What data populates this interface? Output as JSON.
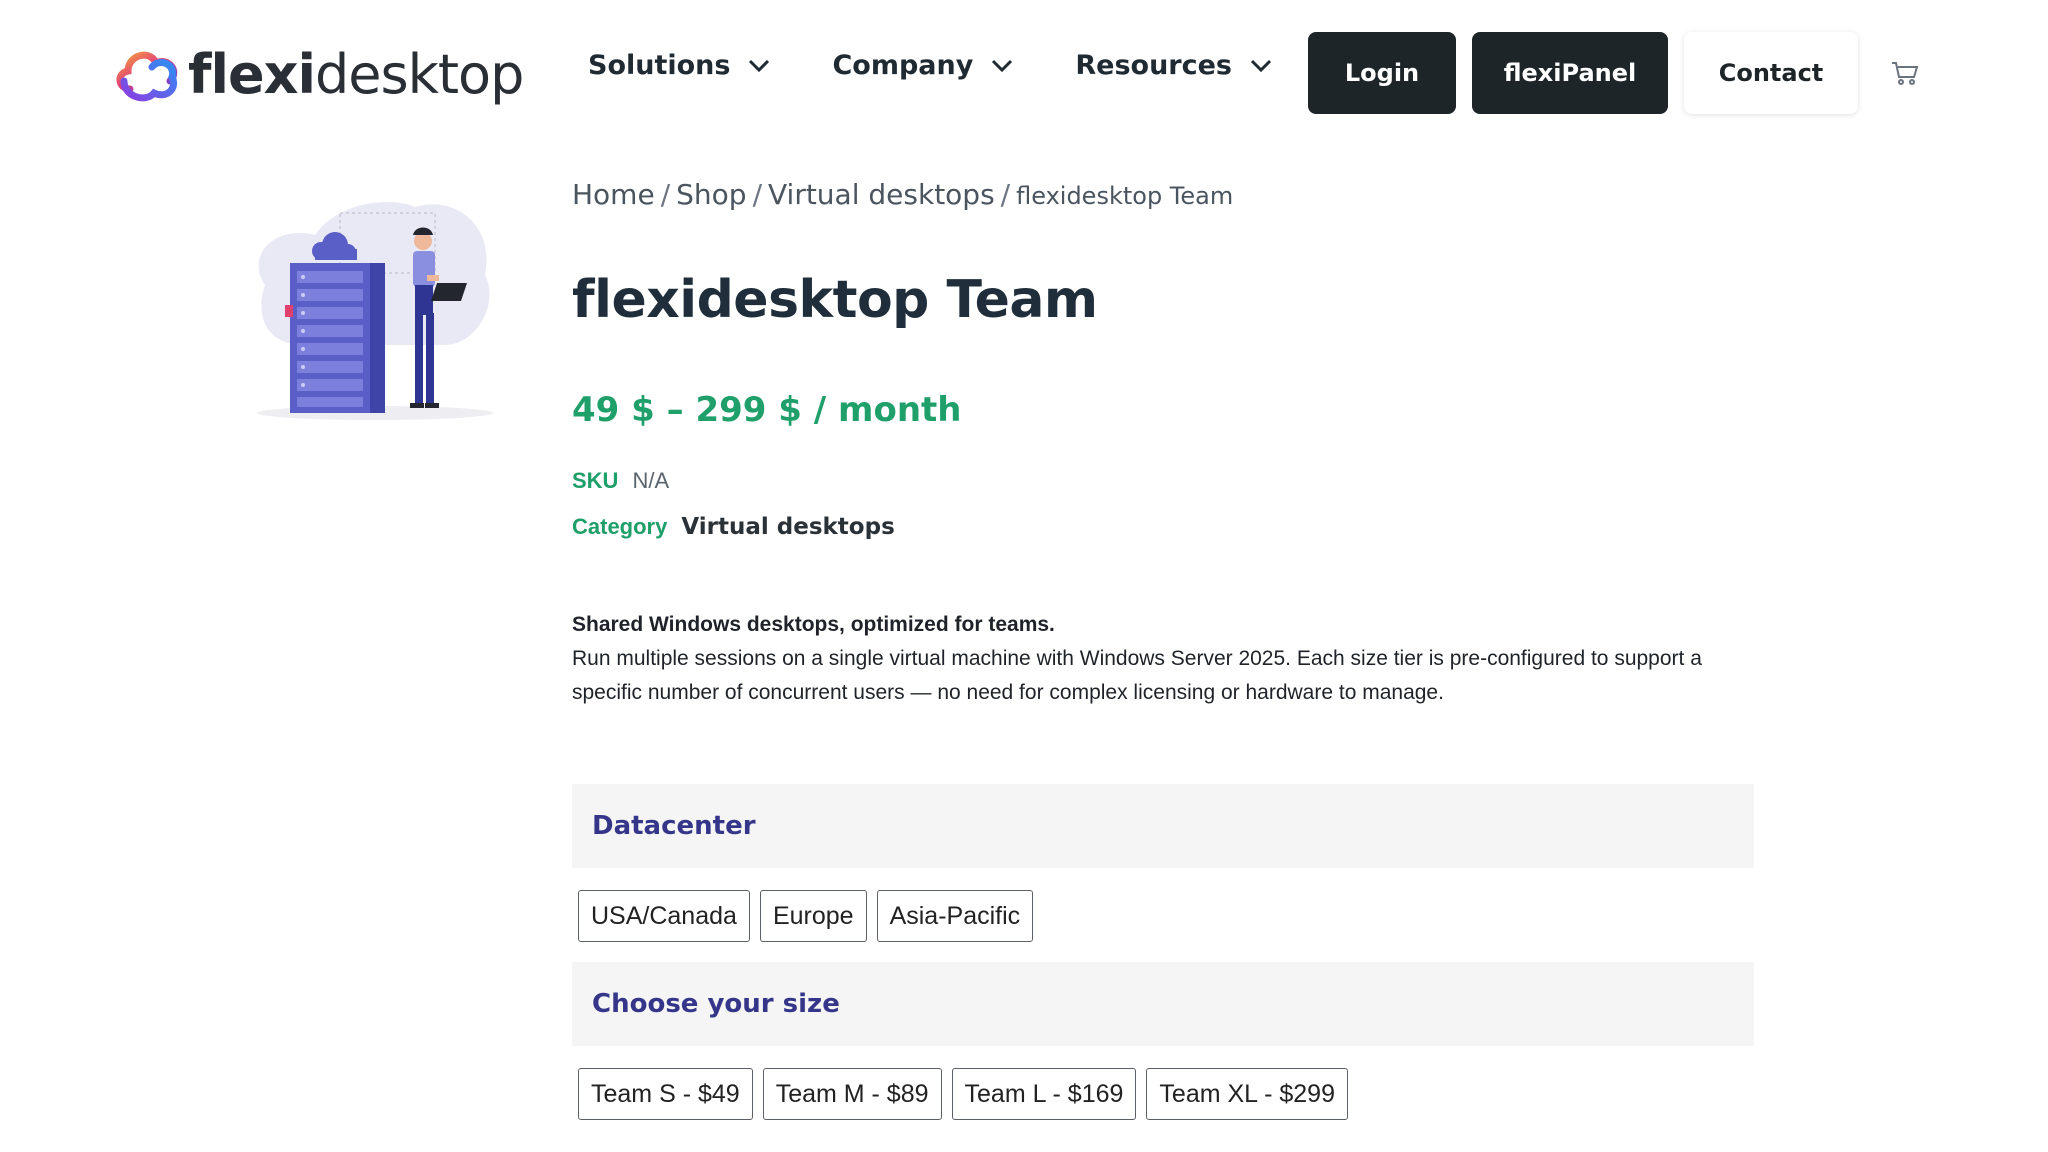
{
  "brand": {
    "name_bold": "flexi",
    "name_rest": "desktop"
  },
  "nav": {
    "items": [
      {
        "label": "Solutions"
      },
      {
        "label": "Company"
      },
      {
        "label": "Resources"
      }
    ],
    "login_label": "Login",
    "panel_label": "flexiPanel",
    "contact_label": "Contact",
    "cart_icon": "cart-icon"
  },
  "breadcrumb": {
    "items": [
      "Home",
      "Shop",
      "Virtual desktops"
    ],
    "current": "flexidesktop Team"
  },
  "product": {
    "title": "flexidesktop Team",
    "price": "49 $ – 299 $ / month",
    "sku_label": "SKU",
    "sku_value": "N/A",
    "category_label": "Category",
    "category_value": "Virtual desktops",
    "description_bold": "Shared Windows desktops, optimized for teams.",
    "description": "Run multiple sessions on a single virtual machine with Windows Server 2025. Each size tier is pre-configured to support a specific number of concurrent users — no need for complex licensing or hardware to manage."
  },
  "datacenter": {
    "heading": "Datacenter",
    "options": [
      "USA/Canada",
      "Europe",
      "Asia-Pacific"
    ]
  },
  "size": {
    "heading": "Choose your size",
    "options": [
      "Team S - $49",
      "Team M - $89",
      "Team L - $169",
      "Team XL - $299"
    ]
  },
  "colors": {
    "accent_green": "#1f9f6a",
    "heading_purple": "#35368a",
    "dark_button": "#1e2529"
  }
}
